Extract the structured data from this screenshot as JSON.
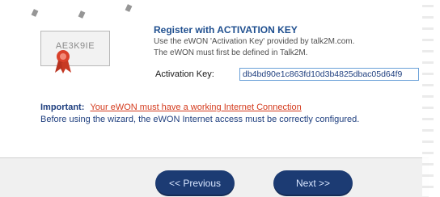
{
  "header": {
    "title": "Register with ACTIVATION KEY",
    "desc_line1": "Use the eWON 'Activation Key' provided by talk2M.com.",
    "desc_line2": "The eWON must first be defined in Talk2M."
  },
  "logo": {
    "text": "AE3K9IE"
  },
  "activation": {
    "label": "Activation Key:",
    "value": "db4bd90e1c863fd10d3b4825dbac05d64f9"
  },
  "notice": {
    "important_label": "Important:",
    "link_text": "Your eWON must have a working Internet Connection",
    "before_text": "Before using the wizard, the eWON Internet access must be correctly configured."
  },
  "buttons": {
    "previous": "<< Previous",
    "next": "Next >>"
  },
  "colors": {
    "title": "#1f4f8f",
    "link": "#d43a1c",
    "button": "#1c3b73"
  }
}
